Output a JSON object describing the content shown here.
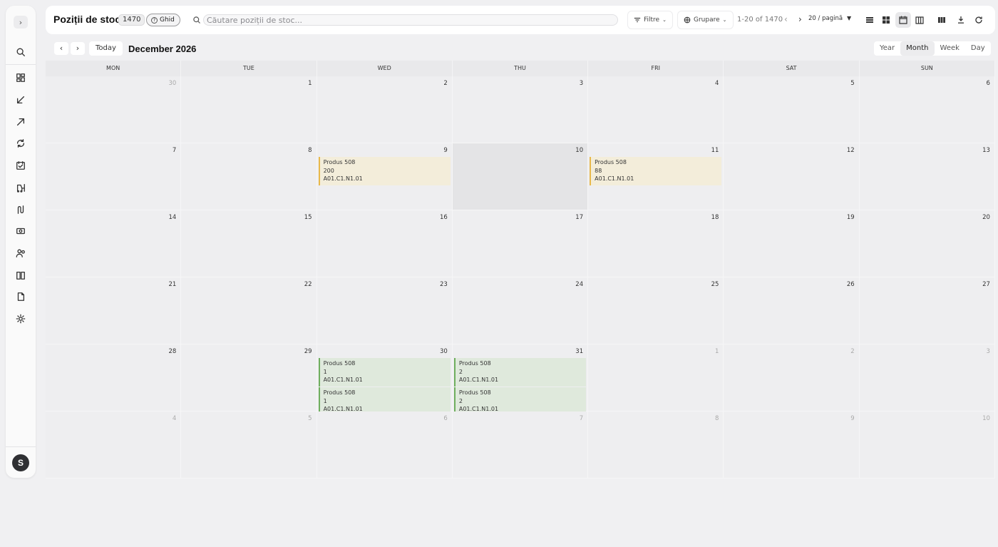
{
  "sidebar": {
    "toggle_icon": "›",
    "items": [
      {
        "name": "search-icon"
      },
      {
        "name": "dashboard-icon"
      },
      {
        "name": "arrow-down-left-icon"
      },
      {
        "name": "arrow-up-right-icon"
      },
      {
        "name": "refresh-icon"
      },
      {
        "name": "inventory-icon"
      },
      {
        "name": "forklift-icon"
      },
      {
        "name": "route-icon"
      },
      {
        "name": "money-icon"
      },
      {
        "name": "users-icon"
      },
      {
        "name": "book-icon"
      },
      {
        "name": "file-icon"
      },
      {
        "name": "settings-icon"
      }
    ],
    "avatar_initial": "S"
  },
  "header": {
    "title": "Poziții de stoc",
    "count": "1470",
    "guide_label": "Ghid",
    "search_placeholder": "Căutare poziții de stoc...",
    "filters_label": "Filtre",
    "grouping_label": "Grupare",
    "pager_text": "1-20 of 1470",
    "per_page_label": "20 / pagină"
  },
  "calendar": {
    "today_label": "Today",
    "title": "December 2026",
    "views": {
      "year": "Year",
      "month": "Month",
      "week": "Week",
      "day": "Day"
    },
    "active_view": "Month",
    "weekdays": [
      "MON",
      "TUE",
      "WED",
      "THU",
      "FRI",
      "SAT",
      "SUN"
    ],
    "weeks": [
      [
        "30",
        "1",
        "2",
        "3",
        "4",
        "5",
        "6"
      ],
      [
        "7",
        "8",
        "9",
        "10",
        "11",
        "12",
        "13"
      ],
      [
        "14",
        "15",
        "16",
        "17",
        "18",
        "19",
        "20"
      ],
      [
        "21",
        "22",
        "23",
        "24",
        "25",
        "26",
        "27"
      ],
      [
        "28",
        "29",
        "30",
        "31",
        "1",
        "2",
        "3"
      ],
      [
        "4",
        "5",
        "6",
        "7",
        "8",
        "9",
        "10"
      ]
    ],
    "events": [
      {
        "product": "Produs 508",
        "qty": "200",
        "location": "A01.C1.N1.01",
        "status": "planned"
      },
      {
        "product": "Produs 508",
        "qty": "88",
        "location": "A01.C1.N1.01",
        "status": "planned"
      },
      {
        "product": "Produs 508",
        "qty": "1",
        "location": "A01.C1.N1.01",
        "status": "done"
      },
      {
        "product": "Produs 508",
        "qty": "1",
        "location": "A01.C1.N1.01",
        "status": "done"
      },
      {
        "product": "Produs 508",
        "qty": "2",
        "location": "A01.C1.N1.01",
        "status": "done"
      },
      {
        "product": "Produs 508",
        "qty": "2",
        "location": "A01.C1.N1.01",
        "status": "done"
      }
    ]
  },
  "colors": {
    "planned_bg": "#f3edda",
    "planned_border": "#e8b84a",
    "done_bg": "#dfe9dc",
    "done_border": "#6fae5e"
  }
}
